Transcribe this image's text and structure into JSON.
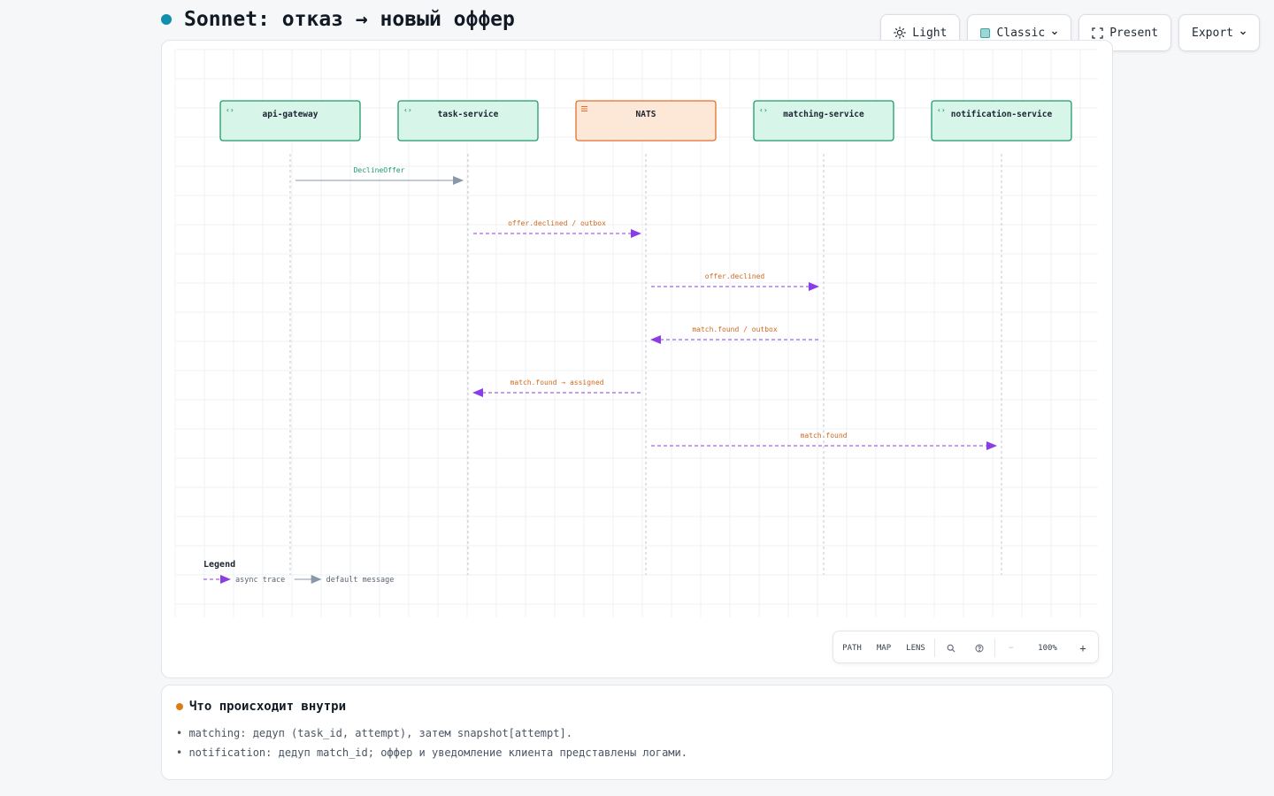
{
  "page": {
    "title": "Sonnet: отказ → новый оффер"
  },
  "toolbar": {
    "light": {
      "label": "Light",
      "icon": "sun-icon"
    },
    "classic": {
      "label": "Classic",
      "icon": "theme-swatch-icon"
    },
    "present": {
      "label": "Present",
      "icon": "fullscreen-icon"
    },
    "export": {
      "label": "Export",
      "icon": "chevron-down-icon"
    }
  },
  "diagram": {
    "participants": [
      {
        "id": "api-gateway",
        "label": "api-gateway",
        "kind": "service",
        "icon": "code-icon"
      },
      {
        "id": "task-service",
        "label": "task-service",
        "kind": "service",
        "icon": "code-icon"
      },
      {
        "id": "nats",
        "label": "NATS",
        "kind": "queue",
        "icon": "queue-icon"
      },
      {
        "id": "matching-service",
        "label": "matching-service",
        "kind": "service",
        "icon": "code-icon"
      },
      {
        "id": "notification-service",
        "label": "notification-service",
        "kind": "service",
        "icon": "code-icon"
      }
    ],
    "messages": [
      {
        "from": "api-gateway",
        "to": "task-service",
        "label": "DeclineOffer",
        "style": "default"
      },
      {
        "from": "task-service",
        "to": "nats",
        "label": "offer.declined / outbox",
        "style": "async"
      },
      {
        "from": "nats",
        "to": "matching-service",
        "label": "offer.declined",
        "style": "async"
      },
      {
        "from": "matching-service",
        "to": "nats",
        "label": "match.found / outbox",
        "style": "async"
      },
      {
        "from": "nats",
        "to": "task-service",
        "label": "match.found → assigned",
        "style": "async"
      },
      {
        "from": "nats",
        "to": "notification-service",
        "label": "match.found",
        "style": "async"
      }
    ],
    "legend": {
      "title": "Legend",
      "items": [
        {
          "style": "async",
          "label": "async trace"
        },
        {
          "style": "default",
          "label": "default message"
        }
      ]
    },
    "colors": {
      "service_fill": "#d8f5ea",
      "service_stroke": "#1f9a6c",
      "queue_fill": "#fde7d6",
      "queue_stroke": "#e2702a",
      "async_line": "#8a3ce6",
      "async_label": "#d2691e",
      "default_line": "#8a97a8",
      "default_label": "#1f9a6c",
      "lifeline": "#c3c8cf",
      "grid": "#eef0f3"
    }
  },
  "zoom_bar": {
    "path": "PATH",
    "map": "MAP",
    "lens": "LENS",
    "zoom": "100%",
    "minus": "−",
    "plus": "+"
  },
  "info": {
    "title": "Что происходит внутри",
    "lines": [
      "• matching: дедуп (task_id, attempt), затем snapshot[attempt].",
      "• notification: дедуп match_id; оффер и уведомление клиента представлены логами."
    ]
  }
}
